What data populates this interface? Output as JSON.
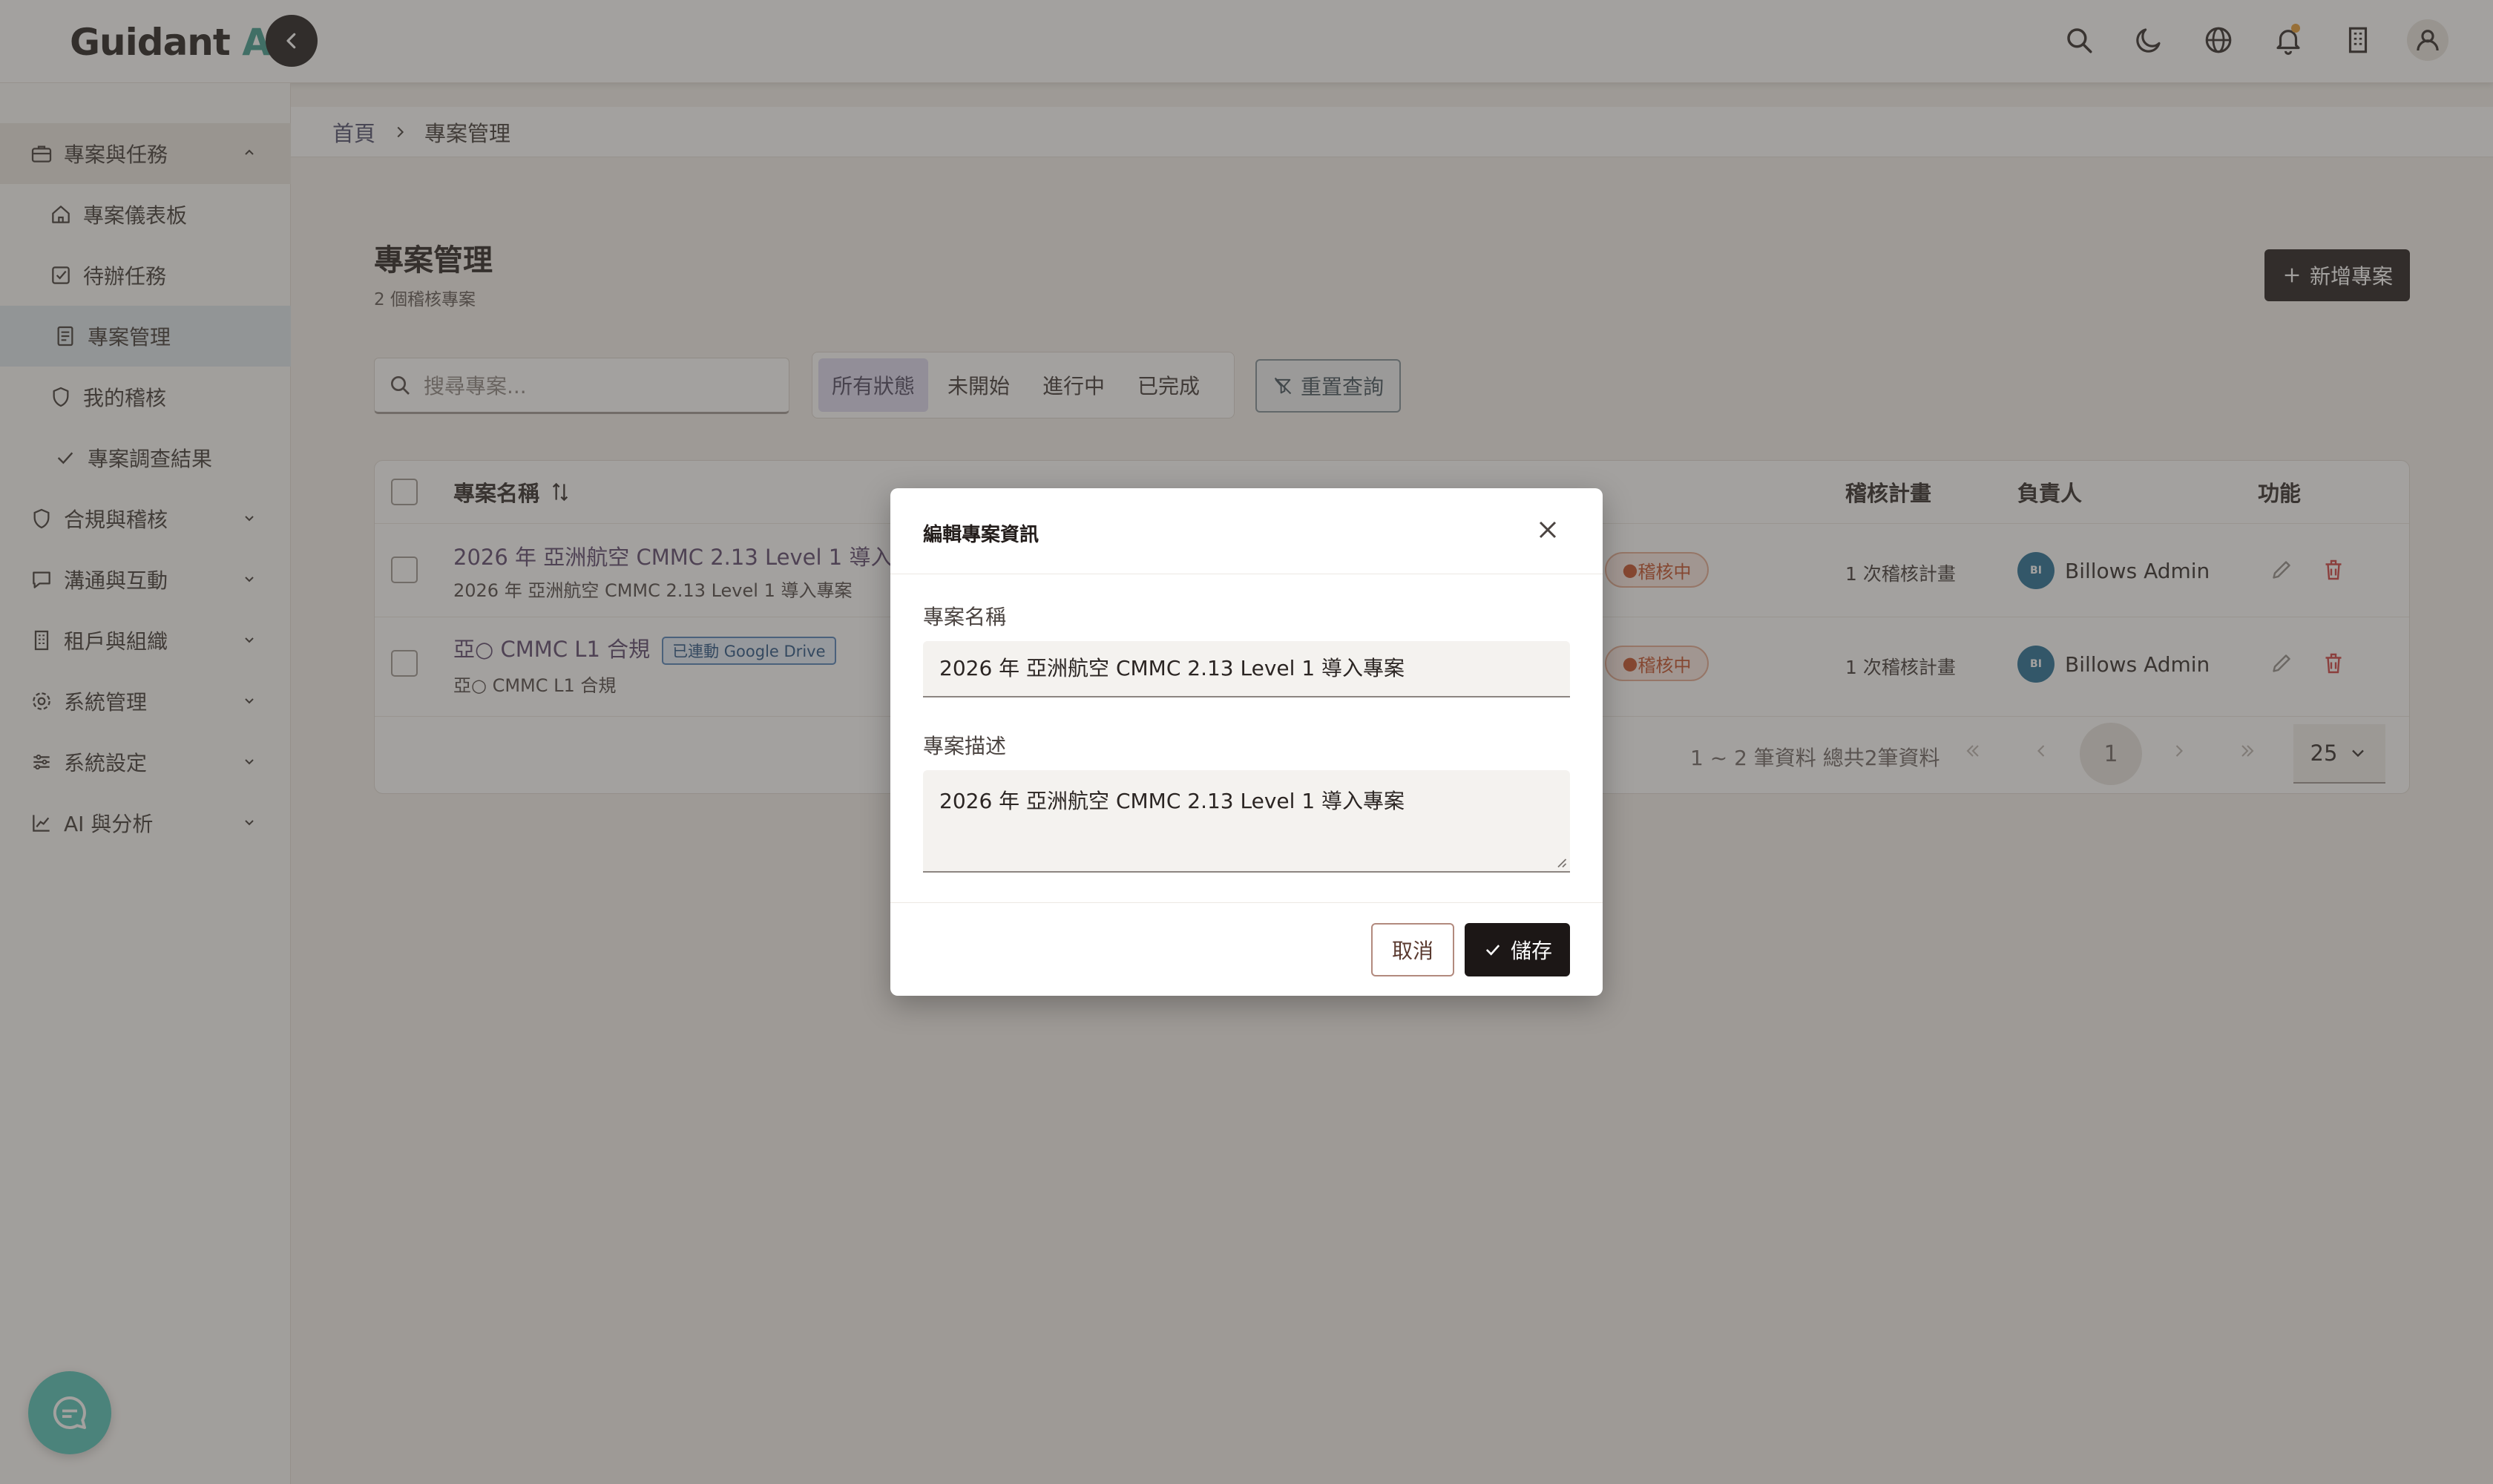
{
  "header": {
    "brand": "Guidant",
    "brand_ai": "AI"
  },
  "sidebar": {
    "groups": [
      {
        "label": "專案與任務",
        "icon": "briefcase-icon",
        "expanded": true
      },
      {
        "label": "合規與稽核",
        "icon": "shield-icon",
        "expanded": false
      },
      {
        "label": "溝通與互動",
        "icon": "chat-icon",
        "expanded": false
      },
      {
        "label": "租戶與組織",
        "icon": "building-icon",
        "expanded": false
      },
      {
        "label": "系統管理",
        "icon": "gear-icon",
        "expanded": false
      },
      {
        "label": "系統設定",
        "icon": "sliders-icon",
        "expanded": false
      },
      {
        "label": "AI 與分析",
        "icon": "chart-icon",
        "expanded": false
      }
    ],
    "sub_items": [
      {
        "label": "專案儀表板",
        "icon": "home-icon"
      },
      {
        "label": "待辦任務",
        "icon": "checkbox-icon"
      },
      {
        "label": "專案管理",
        "icon": "document-icon",
        "active": true
      },
      {
        "label": "我的稽核",
        "icon": "shield-icon"
      },
      {
        "label": "專案調查結果",
        "icon": "check-icon"
      }
    ]
  },
  "breadcrumb": {
    "home": "首頁",
    "current": "專案管理"
  },
  "page": {
    "title": "專案管理",
    "subtitle": "2 個稽核專案",
    "add_button": "新增專案"
  },
  "filters": {
    "search_placeholder": "搜尋專案...",
    "status_tabs": [
      "所有狀態",
      "未開始",
      "進行中",
      "已完成"
    ],
    "active_tab": "所有狀態",
    "reset_button": "重置查詢"
  },
  "table": {
    "columns": [
      "專案名稱",
      "稽核計畫",
      "負責人",
      "功能"
    ],
    "rows": [
      {
        "name": "2026 年 亞洲航空 CMMC 2.13 Level 1 導入專案",
        "description": "2026 年 亞洲航空 CMMC 2.13 Level 1 導入專案",
        "badge": "",
        "status": "稽核中",
        "plan": "1 次稽核計畫",
        "owner_initials": "BI",
        "owner": "Billows Admin"
      },
      {
        "name": "亞○ CMMC L1 合規",
        "description": "亞○ CMMC L1 合規",
        "badge": "已連動 Google Drive",
        "status": "稽核中",
        "plan": "1 次稽核計畫",
        "owner_initials": "BI",
        "owner": "Billows Admin"
      }
    ],
    "pagination": {
      "summary": "1 ~ 2 筆資料 總共2筆資料",
      "current_page": "1",
      "per_page": "25"
    }
  },
  "modal": {
    "title": "編輯專案資訊",
    "name_label": "專案名稱",
    "name_value": "2026 年 亞洲航空 CMMC 2.13 Level 1 導入專案",
    "desc_label": "專案描述",
    "desc_value": "2026 年 亞洲航空 CMMC 2.13 Level 1 導入專案",
    "cancel": "取消",
    "save": "儲存"
  },
  "colors": {
    "brand_accent": "#3a9b8c",
    "primary_dark": "#1c1716",
    "status_audit": "#c24a22",
    "chat_fab": "#4fc3b6"
  }
}
